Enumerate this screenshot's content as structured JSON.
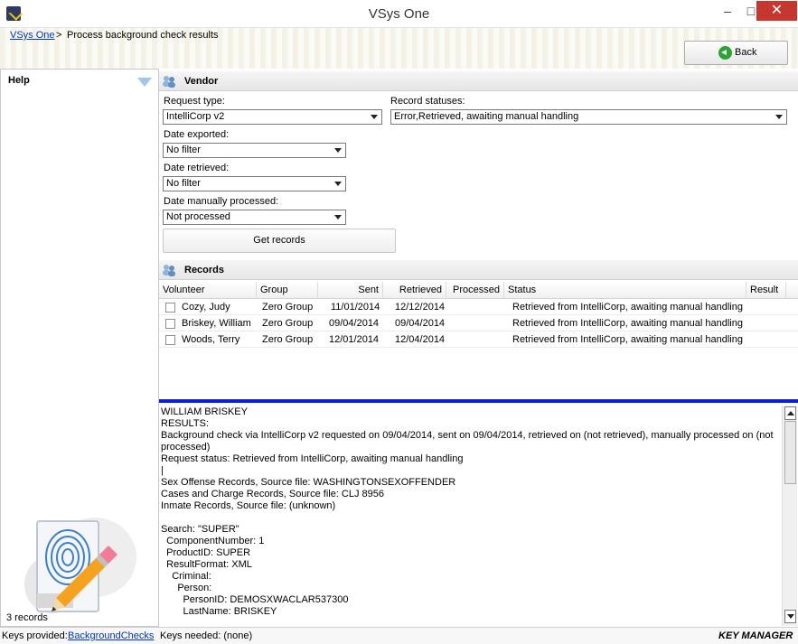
{
  "window": {
    "title": "VSys One",
    "minimize": "–",
    "maximize": "□",
    "close": "✕"
  },
  "breadcrumb": {
    "root": "VSys One",
    "separator": ">",
    "current": "Process background check results"
  },
  "toolbar": {
    "back_label": "Back"
  },
  "help": {
    "title": "Help",
    "record_count": "3  records"
  },
  "vendor": {
    "title": "Vendor",
    "request_type": {
      "label": "Request type:",
      "value": "IntelliCorp v2"
    },
    "record_statuses": {
      "label": "Record statuses:",
      "value": "Error,Retrieved, awaiting manual handling"
    },
    "date_exported": {
      "label": "Date exported:",
      "value": "No filter"
    },
    "date_retrieved": {
      "label": "Date retrieved:",
      "value": "No filter"
    },
    "date_manually_processed": {
      "label": "Date manually processed:",
      "value": "Not processed"
    },
    "get_records_label": "Get records"
  },
  "records": {
    "title": "Records",
    "columns": [
      "Volunteer",
      "Group",
      "Sent",
      "Retrieved",
      "Processed",
      "Status",
      "Result"
    ],
    "rows": [
      {
        "volunteer": "Cozy, Judy",
        "group": "Zero Group",
        "sent": "11/01/2014",
        "retrieved": "12/12/2014",
        "processed": "",
        "status": "Retrieved from IntelliCorp, awaiting manual handling",
        "result": ""
      },
      {
        "volunteer": "Briskey, William",
        "group": "Zero Group",
        "sent": "09/04/2014",
        "retrieved": "09/04/2014",
        "processed": "",
        "status": "Retrieved from IntelliCorp, awaiting manual handling",
        "result": ""
      },
      {
        "volunteer": "Woods, Terry",
        "group": "Zero Group",
        "sent": "12/01/2014",
        "retrieved": "12/04/2014",
        "processed": "",
        "status": "Retrieved from IntelliCorp, awaiting manual handling",
        "result": ""
      }
    ]
  },
  "detail": {
    "text": "WILLIAM BRISKEY\nRESULTS:\nBackground check via IntelliCorp v2 requested on 09/04/2014, sent on 09/04/2014, retrieved on (not retrieved), manually processed on (not processed)\nRequest status: Retrieved from IntelliCorp, awaiting manual handling\n|\nSex Offense Records, Source file: WASHINGTONSEXOFFENDER\nCases and Charge Records, Source file: CLJ 8956\nInmate Records, Source file: (unknown)\n\nSearch: \"SUPER\"\n  ComponentNumber: 1\n  ProductID: SUPER\n  ResultFormat: XML\n    Criminal:\n      Person:\n        PersonID: DEMOSXWACLAR537300\n        LastName: BRISKEY"
  },
  "statusbar": {
    "keys_provided_label": "Keys provided:",
    "keys_provided_link": "BackgroundChecks",
    "keys_needed": "Keys needed: (none)",
    "brand": "KEY MANAGER"
  },
  "colors": {
    "accent_rule": "#0a1de0",
    "link": "#0033cc",
    "close_button": "#c7372f",
    "back_icon": "#2aa532"
  }
}
